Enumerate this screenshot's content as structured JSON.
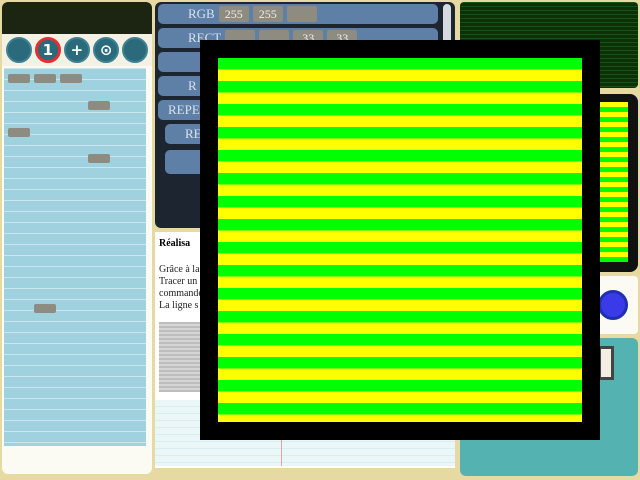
{
  "toolbar": {
    "buttons": [
      "",
      "1",
      "+",
      "⊙",
      ""
    ]
  },
  "commands": [
    {
      "label": "RGB",
      "values": [
        "255",
        "255",
        ""
      ]
    },
    {
      "label": "RECT",
      "values": [
        "",
        "",
        "33",
        "33"
      ]
    },
    {
      "label": "",
      "values": []
    },
    {
      "label": "R",
      "values": []
    },
    {
      "label": "REPE",
      "values": []
    },
    {
      "label": "RE",
      "values": []
    }
  ],
  "left_grid": {
    "chip_values": [
      "",
      "",
      "",
      "",
      "",
      "",
      "",
      "",
      "",
      ""
    ]
  },
  "help": {
    "title": "Réalisa",
    "lines": [
      "Grâce à la",
      "Tracer un",
      "commande",
      "La ligne s"
    ]
  },
  "canvas": {
    "stripe_colors": [
      "#00ff00",
      "#ffff00"
    ]
  }
}
